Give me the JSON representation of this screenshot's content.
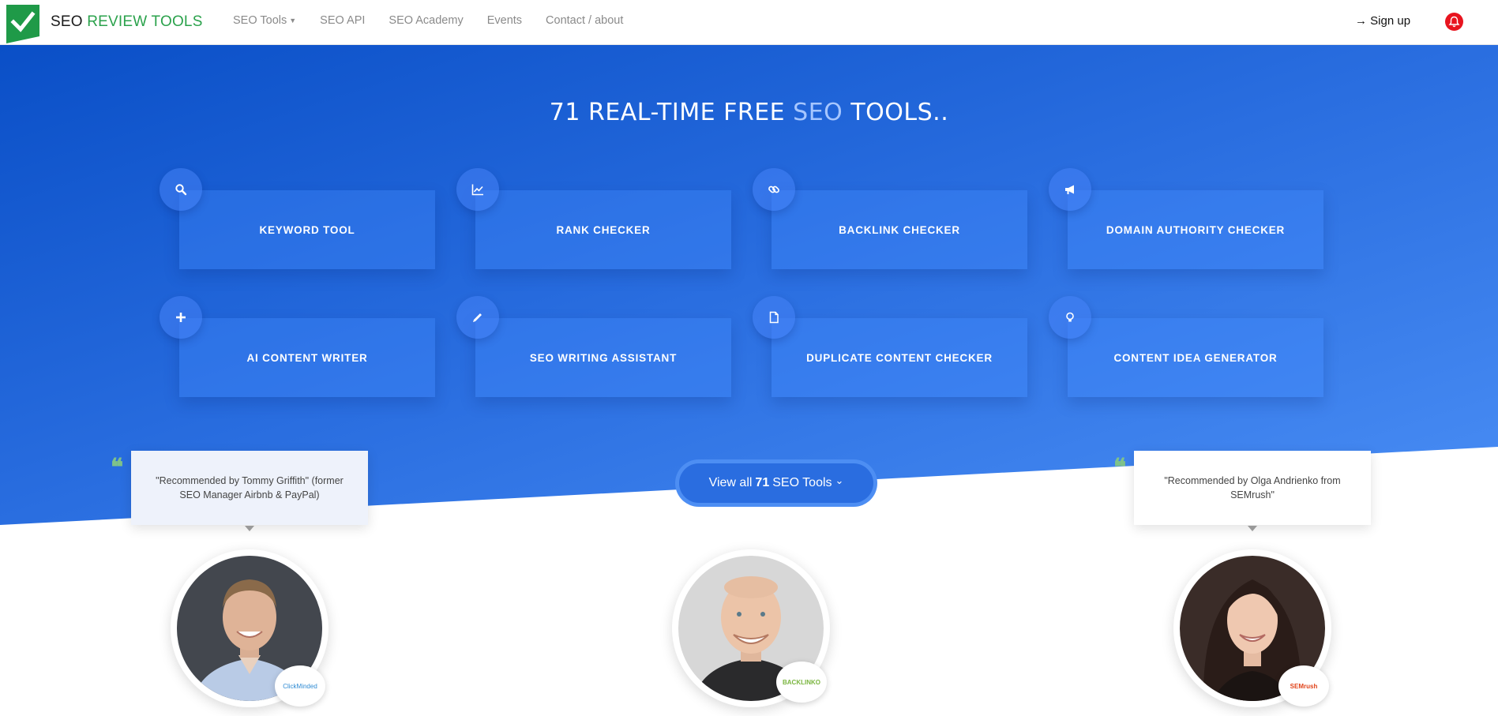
{
  "navbar": {
    "logo_part1": "SEO",
    "logo_part2": "REVIEW TOOLS",
    "links": [
      {
        "label": "SEO Tools",
        "has_caret": true
      },
      {
        "label": "SEO API"
      },
      {
        "label": "SEO Academy"
      },
      {
        "label": "Events"
      },
      {
        "label": "Contact / about"
      }
    ],
    "signup_label": "→ Sign up",
    "colors": {
      "brand_green": "#2ba24c",
      "bell_red": "#e8141f"
    }
  },
  "hero": {
    "title_before": "71 REAL-TIME FREE",
    "title_highlight": "SEO",
    "title_after": "TOOLS..",
    "tools": [
      {
        "label": "KEYWORD TOOL",
        "icon": "search-icon"
      },
      {
        "label": "RANK CHECKER",
        "icon": "line-chart-icon"
      },
      {
        "label": "BACKLINK CHECKER",
        "icon": "link-icon"
      },
      {
        "label": "DOMAIN AUTHORITY CHECKER",
        "icon": "megaphone-icon"
      },
      {
        "label": "AI CONTENT WRITER",
        "icon": "plus-icon"
      },
      {
        "label": "SEO WRITING ASSISTANT",
        "icon": "pencil-icon"
      },
      {
        "label": "DUPLICATE CONTENT CHECKER",
        "icon": "file-icon"
      },
      {
        "label": "CONTENT IDEA GENERATOR",
        "icon": "lightbulb-icon"
      }
    ]
  },
  "testimonials": {
    "left": {
      "quote": "\"Recommended by Tommy Griffith\" (former SEO Manager Airbnb & PayPal)",
      "company": "ClickMinded"
    },
    "center": {
      "company": "BACKLINKO"
    },
    "right": {
      "quote": "\"Recommended by Olga Andrienko from SEMrush\"",
      "company": "SEMrush"
    }
  },
  "cta": {
    "before": "View all",
    "count": "71",
    "after": "SEO Tools",
    "chevron": "⌄"
  }
}
